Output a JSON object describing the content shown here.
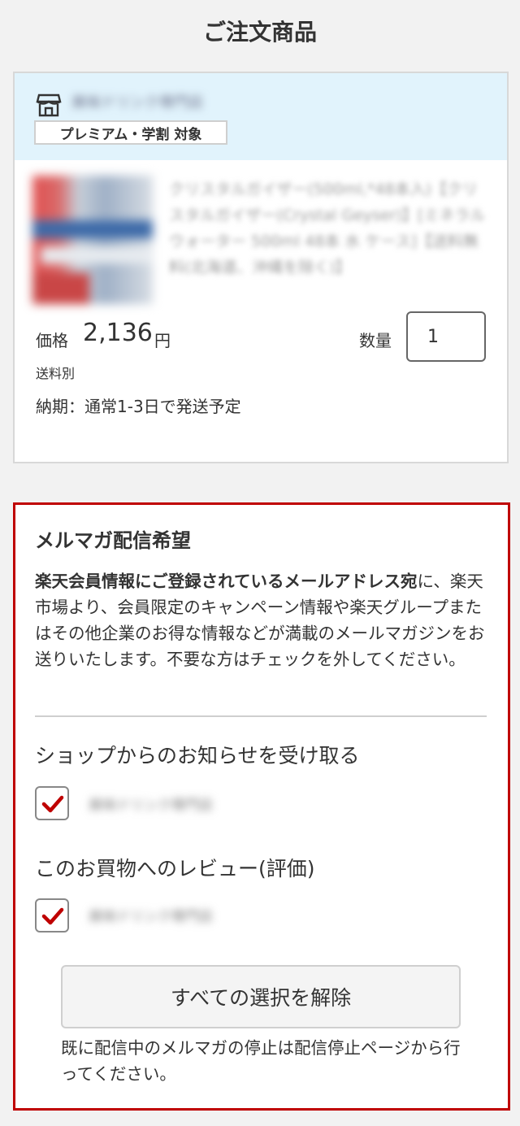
{
  "page": {
    "title": "ご注文商品"
  },
  "order": {
    "shop_name": "美味ドリンク専門店",
    "campaign_badge": "プレミアム・学割 対象",
    "product_title": "クリスタルガイザー(500ml,*48本入)【クリスタルガイザー(Crystal Geyser)】[ミネラルウォーター 500ml 48本 水 ケース]【送料無料(北海道、沖縄を除く)】",
    "price_label": "価格",
    "price_value": "2,136",
    "price_unit": "円",
    "shipping": "送料別",
    "delivery": "納期：通常1-3日で発送予定",
    "quantity_label": "数量",
    "quantity_value": "1"
  },
  "newsletter": {
    "title": "メルマガ配信希望",
    "description_bold": "楽天会員情報にご登録されているメールアドレス宛",
    "description_rest": "に、楽天市場より、会員限定のキャンペーン情報や楽天グループまたはその他企業のお得な情報などが満載のメールマガジンをお送りいたします。不要な方はチェックを外してください。",
    "options": [
      {
        "title": "ショップからのお知らせを受け取る",
        "shop_name": "美味ドリンク専門店",
        "checked": true
      },
      {
        "title": "このお買物へのレビュー(評価)",
        "shop_name": "美味ドリンク専門店",
        "checked": true
      }
    ],
    "clear_all_label": "すべての選択を解除",
    "stop_note": "既に配信中のメルマガの停止は配信停止ページから行ってください。"
  },
  "colors": {
    "accent": "#bf0000",
    "shop_header_bg": "#e1f3fc",
    "checkmark": "#bf0000"
  }
}
